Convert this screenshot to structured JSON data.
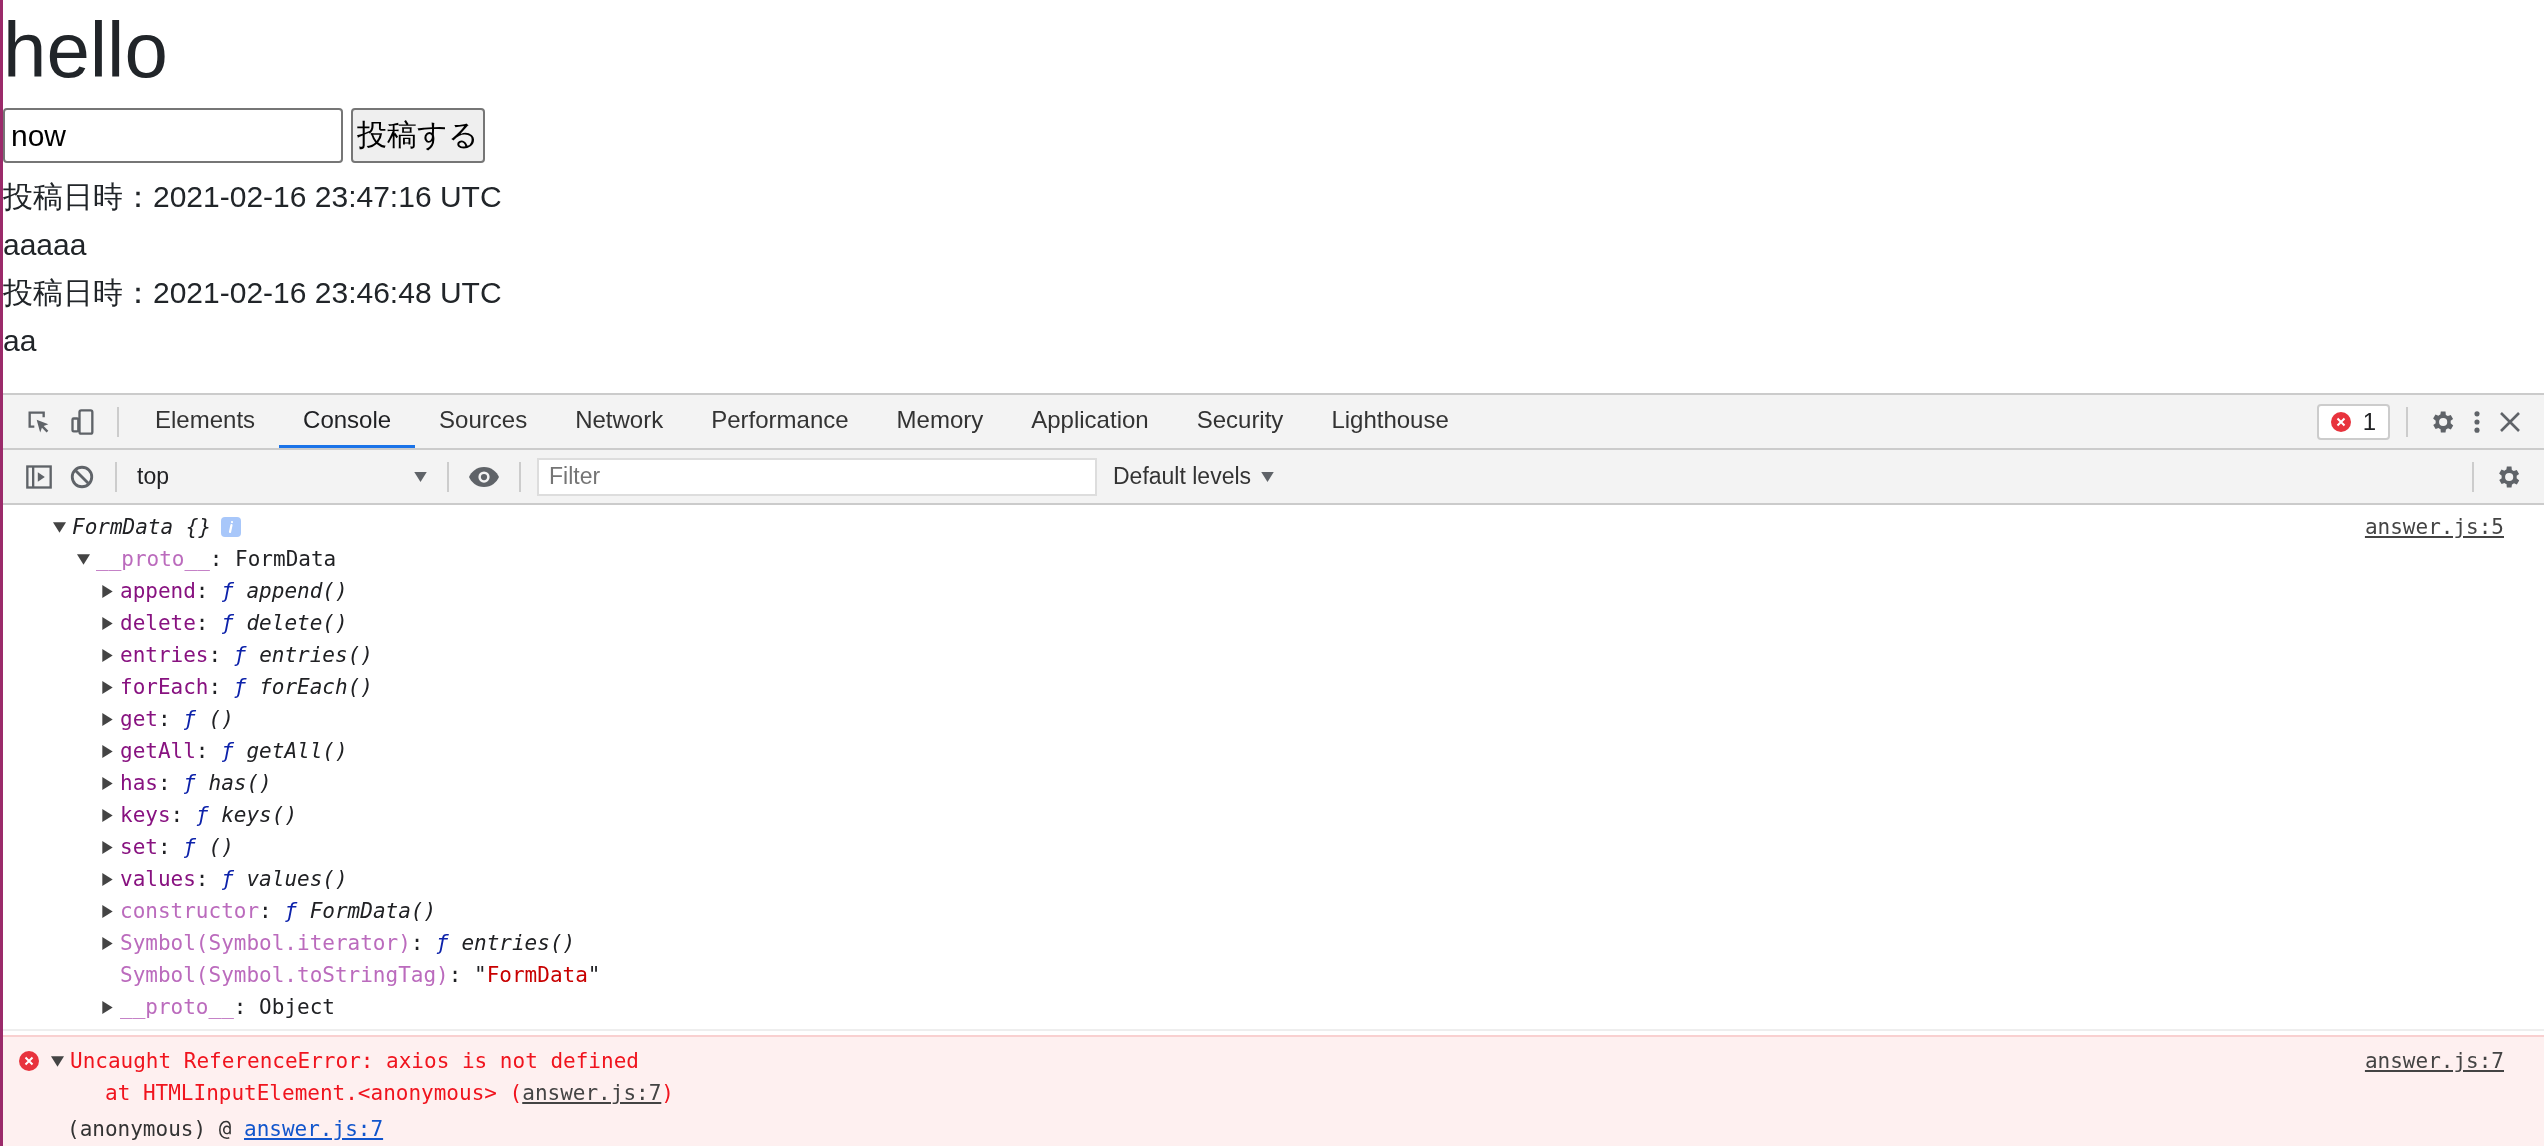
{
  "page": {
    "heading": "hello",
    "post_field": {
      "value": "now"
    },
    "post_button": "投稿する",
    "posts": [
      {
        "timestamp": "投稿日時：2021-02-16 23:47:16 UTC",
        "body": "aaaaa"
      },
      {
        "timestamp": "投稿日時：2021-02-16 23:46:48 UTC",
        "body": "aa"
      }
    ]
  },
  "devtools": {
    "tabs": [
      {
        "label": "Elements",
        "selected": false
      },
      {
        "label": "Console",
        "selected": true
      },
      {
        "label": "Sources",
        "selected": false
      },
      {
        "label": "Network",
        "selected": false
      },
      {
        "label": "Performance",
        "selected": false
      },
      {
        "label": "Memory",
        "selected": false
      },
      {
        "label": "Application",
        "selected": false
      },
      {
        "label": "Security",
        "selected": false
      },
      {
        "label": "Lighthouse",
        "selected": false
      }
    ],
    "error_count": "1",
    "toolbar": {
      "context": "top",
      "filter": {
        "placeholder": "Filter"
      },
      "levels": "Default levels"
    },
    "log": {
      "source": "answer.js:5",
      "label": "FormData {}",
      "expanded": true,
      "proto": {
        "key": "__proto__",
        "sep": ":",
        "value": "FormData",
        "expanded": true,
        "children": [
          {
            "kind": "node",
            "expanded": false,
            "enumerable": true,
            "key": "append",
            "sep": ":",
            "fn": "ƒ",
            "value": "append()"
          },
          {
            "kind": "node",
            "expanded": false,
            "enumerable": true,
            "key": "delete",
            "sep": ":",
            "fn": "ƒ",
            "value": "delete()"
          },
          {
            "kind": "node",
            "expanded": false,
            "enumerable": true,
            "key": "entries",
            "sep": ":",
            "fn": "ƒ",
            "value": "entries()"
          },
          {
            "kind": "node",
            "expanded": false,
            "enumerable": true,
            "key": "forEach",
            "sep": ":",
            "fn": "ƒ",
            "value": "forEach()"
          },
          {
            "kind": "node",
            "expanded": false,
            "enumerable": true,
            "key": "get",
            "sep": ":",
            "fn": "ƒ",
            "value": "()"
          },
          {
            "kind": "node",
            "expanded": false,
            "enumerable": true,
            "key": "getAll",
            "sep": ":",
            "fn": "ƒ",
            "value": "getAll()"
          },
          {
            "kind": "node",
            "expanded": false,
            "enumerable": true,
            "key": "has",
            "sep": ":",
            "fn": "ƒ",
            "value": "has()"
          },
          {
            "kind": "node",
            "expanded": false,
            "enumerable": true,
            "key": "keys",
            "sep": ":",
            "fn": "ƒ",
            "value": "keys()"
          },
          {
            "kind": "node",
            "expanded": false,
            "enumerable": true,
            "key": "set",
            "sep": ":",
            "fn": "ƒ",
            "value": "()"
          },
          {
            "kind": "node",
            "expanded": false,
            "enumerable": true,
            "key": "values",
            "sep": ":",
            "fn": "ƒ",
            "value": "values()"
          },
          {
            "kind": "node",
            "expanded": false,
            "enumerable": false,
            "key": "constructor",
            "sep": ":",
            "fn": "ƒ",
            "value": "FormData()"
          },
          {
            "kind": "node",
            "expanded": false,
            "enumerable": false,
            "key": "Symbol(Symbol.iterator)",
            "sep": ":",
            "fn": "ƒ",
            "value": "entries()"
          },
          {
            "kind": "leaf",
            "enumerable": false,
            "key": "Symbol(Symbol.toStringTag)",
            "sep": ":",
            "quotes": [
              "\"",
              "\""
            ],
            "value": "FormData"
          },
          {
            "kind": "object",
            "expanded": false,
            "enumerable": false,
            "key": "__proto__",
            "sep": ":",
            "value": "Object"
          }
        ]
      }
    },
    "error": {
      "expanded": true,
      "source": "answer.js:7",
      "message": "Uncaught ReferenceError: axios is not defined",
      "stack": {
        "prefix": "at HTMLInputElement.<anonymous> (",
        "link": "answer.js:7",
        "suffix": ")"
      },
      "trace": {
        "fn": "(anonymous) @",
        "link": "answer.js:7"
      }
    }
  }
}
